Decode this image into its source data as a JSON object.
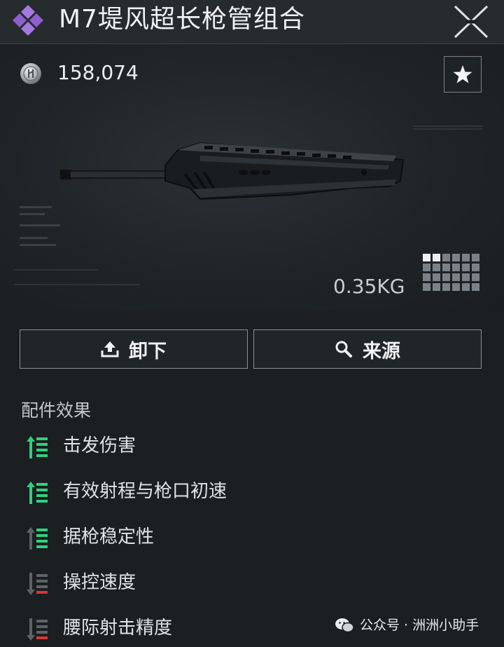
{
  "header": {
    "title": "M7堤风超长枪管组合",
    "logo_icon": "diamond-cluster-icon",
    "close_icon": "close-icon"
  },
  "item": {
    "price": "158,074",
    "currency_icon": "coin-icon",
    "favorite_icon": "star-icon",
    "weight": "0.35KG",
    "grid_size": {
      "cols": 6,
      "rows": 4,
      "highlighted_cells": 2
    }
  },
  "actions": {
    "unequip_label": "卸下",
    "unequip_icon": "upload-icon",
    "source_label": "来源",
    "source_icon": "search-icon"
  },
  "effects": {
    "heading": "配件效果",
    "items": [
      {
        "label": "击发伤害",
        "type": "positive"
      },
      {
        "label": "有效射程与枪口初速",
        "type": "positive"
      },
      {
        "label": "据枪稳定性",
        "type": "positive"
      },
      {
        "label": "操控速度",
        "type": "negative"
      },
      {
        "label": "腰际射击精度",
        "type": "negative"
      }
    ]
  },
  "watermark": {
    "text": "公众号 · 洲洲小助手",
    "icon": "wechat-icon"
  },
  "colors": {
    "positive": "#2fd07e",
    "negative": "#d9343a",
    "accent": "#9a6ad8"
  }
}
